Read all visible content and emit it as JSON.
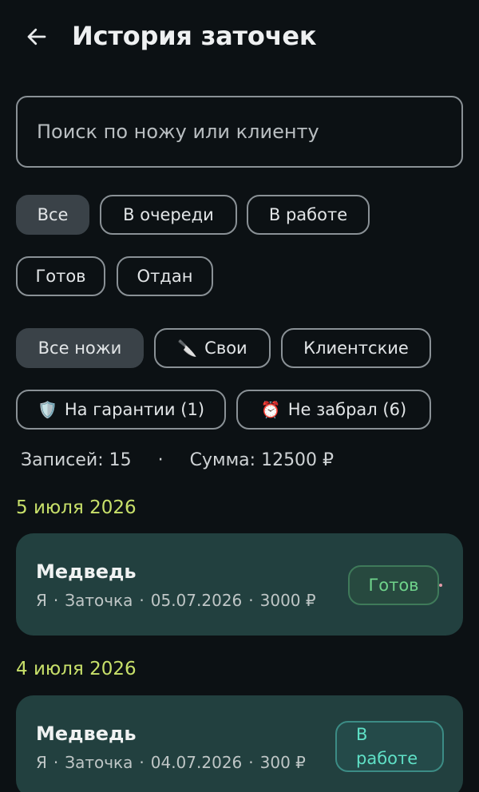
{
  "header": {
    "title": "История заточек",
    "back_icon": "arrow-left-icon"
  },
  "search": {
    "placeholder": "Поиск по ножу или клиенту",
    "value": ""
  },
  "status_filters": [
    {
      "label": "Все",
      "selected": true
    },
    {
      "label": "В очереди",
      "selected": false
    },
    {
      "label": "В работе",
      "selected": false
    },
    {
      "label": "Готов",
      "selected": false
    },
    {
      "label": "Отдан",
      "selected": false
    }
  ],
  "knife_filters": [
    {
      "label": "Все ножи",
      "selected": true
    },
    {
      "label": "Свои",
      "emoji": "🔪",
      "selected": false
    },
    {
      "label": "Клиентские",
      "selected": false
    }
  ],
  "flag_filters": [
    {
      "label": "На гарантии (1)",
      "emoji": "🛡️",
      "selected": false
    },
    {
      "label": "Не забрал (6)",
      "emoji": "⏰",
      "selected": false
    }
  ],
  "summary": {
    "records": "Записей: 15",
    "separator": "·",
    "sum": "Сумма: 12500 ₽"
  },
  "groups": [
    {
      "date": "5 июля 2026",
      "items": [
        {
          "name": "Медведь",
          "owner": "Я",
          "service": "Заточка",
          "date": "05.07.2026",
          "price": "3000 ₽",
          "status": "Готов"
        }
      ]
    },
    {
      "date": "4 июля 2026",
      "items": [
        {
          "name": "Медведь",
          "owner": "Я",
          "service": "Заточка",
          "date": "04.07.2026",
          "price": "300 ₽",
          "status": "В работе"
        }
      ]
    }
  ],
  "colors": {
    "background": "#0c1114",
    "card": "#22403f",
    "date_header": "#c8e06a",
    "status_ready": "#6fd38b",
    "status_work": "#5fe0c6"
  }
}
